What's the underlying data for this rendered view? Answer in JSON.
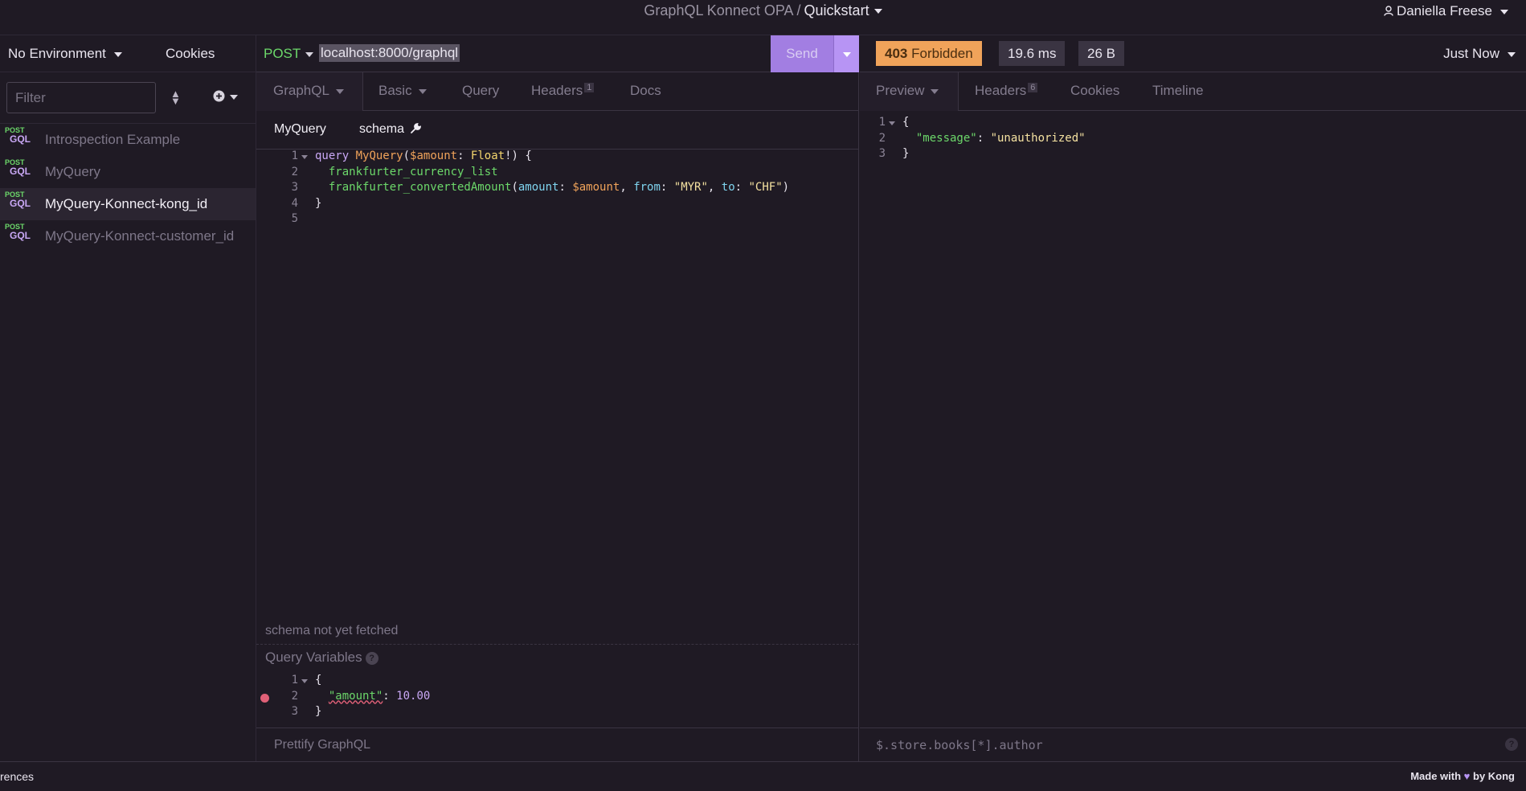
{
  "topbar": {
    "project": "GraphQL Konnect OPA",
    "separator": "/",
    "workspace": "Quickstart",
    "user": "Daniella Freese"
  },
  "sidebar": {
    "environment": "No Environment",
    "cookies": "Cookies",
    "filter_placeholder": "Filter",
    "requests": [
      {
        "method": "POST",
        "type": "GQL",
        "name": "Introspection Example",
        "active": false
      },
      {
        "method": "POST",
        "type": "GQL",
        "name": "MyQuery",
        "active": false
      },
      {
        "method": "POST",
        "type": "GQL",
        "name": "MyQuery-Konnect-kong_id",
        "active": true
      },
      {
        "method": "POST",
        "type": "GQL",
        "name": "MyQuery-Konnect-customer_id",
        "active": false
      }
    ]
  },
  "request": {
    "method": "POST",
    "url": "localhost:8000/graphql",
    "send_label": "Send",
    "tabs": {
      "body": "GraphQL",
      "auth": "Basic",
      "query": "Query",
      "headers": "Headers",
      "headers_count": "1",
      "docs": "Docs"
    },
    "operations": {
      "op1": "MyQuery",
      "op2": "schema"
    },
    "code_lines": [
      "1",
      "2",
      "3",
      "4",
      "5"
    ],
    "code": {
      "l1_kw": "query",
      "l1_name": "MyQuery",
      "l1_var": "$amount",
      "l1_type": "Float",
      "l2_field": "frankfurter_currency_list",
      "l3_field": "frankfurter_convertedAmount",
      "l3_arg1": "amount",
      "l3_val1": "$amount",
      "l3_arg2": "from",
      "l3_val2": "\"MYR\"",
      "l3_arg3": "to",
      "l3_val3": "\"CHF\""
    },
    "schema_status": "schema not yet fetched",
    "query_variables_label": "Query Variables",
    "variables": {
      "key": "\"amount\"",
      "value": "10.00"
    },
    "var_lines": [
      "1",
      "2",
      "3"
    ],
    "prettify": "Prettify GraphQL"
  },
  "response": {
    "status_code": "403",
    "status_text": "Forbidden",
    "time": "19.6 ms",
    "size": "26 B",
    "when": "Just Now",
    "tabs": {
      "preview": "Preview",
      "headers": "Headers",
      "headers_count": "6",
      "cookies": "Cookies",
      "timeline": "Timeline"
    },
    "body_lines": [
      "1",
      "2",
      "3"
    ],
    "body": {
      "key": "\"message\"",
      "value": "\"unauthorized\""
    },
    "jsonpath_placeholder": "$.store.books[*].author",
    "status_color": "#f0a35a"
  },
  "statusbar": {
    "preferences": "rences",
    "made_with_prefix": "Made with",
    "heart": "♥",
    "made_with_suffix": "by Kong"
  },
  "colors": {
    "accent": "#b794f4",
    "post": "#6cd86a",
    "background": "#1f1a24"
  }
}
